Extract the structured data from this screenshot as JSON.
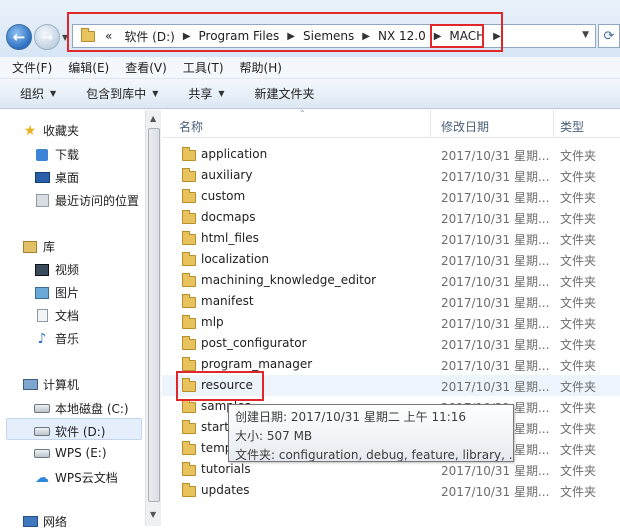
{
  "address": {
    "overflow": "«",
    "crumbs": [
      "软件 (D:)",
      "Program Files",
      "Siemens",
      "NX 12.0",
      "MACH"
    ]
  },
  "menu": [
    "文件(F)",
    "编辑(E)",
    "查看(V)",
    "工具(T)",
    "帮助(H)"
  ],
  "commands": [
    "组织",
    "包含到库中",
    "共享",
    "新建文件夹"
  ],
  "nav": {
    "favorites": "收藏夹",
    "downloads": "下载",
    "desktop": "桌面",
    "recent": "最近访问的位置",
    "libraries": "库",
    "videos": "视频",
    "pictures": "图片",
    "documents": "文档",
    "music": "音乐",
    "computer": "计算机",
    "drive_c": "本地磁盘 (C:)",
    "drive_d": "软件 (D:)",
    "drive_e": "WPS (E:)",
    "wps_cloud": "WPS云文档",
    "network": "网络"
  },
  "columns": {
    "name": "名称",
    "date": "修改日期",
    "type": "类型"
  },
  "files": [
    {
      "name": "application",
      "date": "2017/10/31 星期...",
      "type": "文件夹"
    },
    {
      "name": "auxiliary",
      "date": "2017/10/31 星期...",
      "type": "文件夹"
    },
    {
      "name": "custom",
      "date": "2017/10/31 星期...",
      "type": "文件夹"
    },
    {
      "name": "docmaps",
      "date": "2017/10/31 星期...",
      "type": "文件夹"
    },
    {
      "name": "html_files",
      "date": "2017/10/31 星期...",
      "type": "文件夹"
    },
    {
      "name": "localization",
      "date": "2017/10/31 星期...",
      "type": "文件夹"
    },
    {
      "name": "machining_knowledge_editor",
      "date": "2017/10/31 星期...",
      "type": "文件夹"
    },
    {
      "name": "manifest",
      "date": "2017/10/31 星期...",
      "type": "文件夹"
    },
    {
      "name": "mlp",
      "date": "2017/10/31 星期...",
      "type": "文件夹"
    },
    {
      "name": "post_configurator",
      "date": "2017/10/31 星期...",
      "type": "文件夹"
    },
    {
      "name": "program_manager",
      "date": "2017/10/31 星期...",
      "type": "文件夹"
    },
    {
      "name": "resource",
      "date": "2017/10/31 星期...",
      "type": "文件夹"
    },
    {
      "name": "samples",
      "date": "2017/10/31 星期...",
      "type": "文件夹"
    },
    {
      "name": "startup",
      "date": "2017/10/31 星期...",
      "type": "文件夹"
    },
    {
      "name": "templates",
      "date": "2017/10/31 星期...",
      "type": "文件夹"
    },
    {
      "name": "tutorials",
      "date": "2017/10/31 星期...",
      "type": "文件夹"
    },
    {
      "name": "updates",
      "date": "2017/10/31 星期...",
      "type": "文件夹"
    }
  ],
  "tooltip": {
    "created": "创建日期: 2017/10/31 星期二 上午 11:16",
    "size": "大小: 507 MB",
    "folders": "文件夹: configuration, debug, feature, library, ..."
  },
  "colors": {
    "highlight_box": "#e0272c",
    "hover_row": "#eef4fb"
  }
}
